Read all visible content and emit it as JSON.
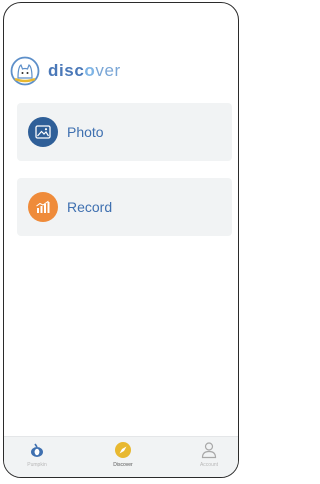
{
  "app": {
    "brand_prefix": "disc",
    "brand_o": "o",
    "brand_suffix": "ver"
  },
  "cards": [
    {
      "label": "Photo",
      "icon": "image-icon",
      "color": "#2f5f98"
    },
    {
      "label": "Record",
      "icon": "chart-icon",
      "color": "#ef8b3a"
    }
  ],
  "tabbar": {
    "tabs": [
      {
        "label": "Pumpkin",
        "icon": "pumpkin-icon",
        "active": false
      },
      {
        "label": "Discover",
        "icon": "compass-icon",
        "active": true
      },
      {
        "label": "Account",
        "icon": "person-icon",
        "active": false
      }
    ]
  },
  "colors": {
    "accent": "#4a78b8",
    "photo": "#2f5f98",
    "record": "#ef8b3a",
    "discover_active": "#e8b830"
  }
}
